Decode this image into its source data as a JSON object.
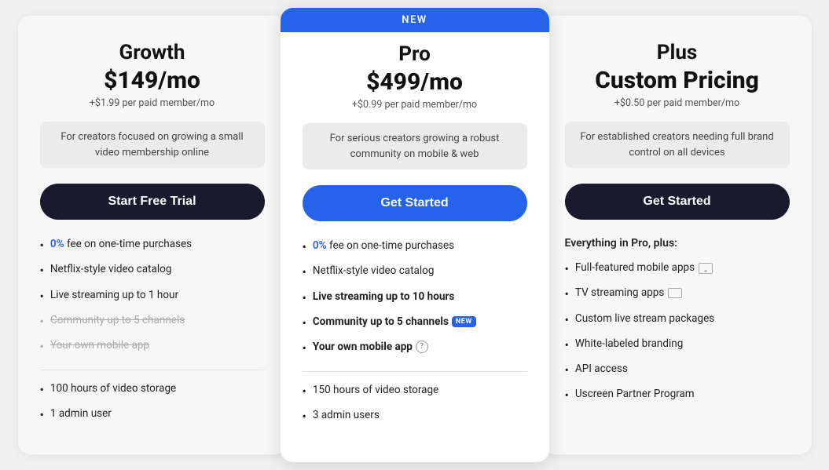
{
  "plans": [
    {
      "id": "growth",
      "position": "left",
      "name": "Growth",
      "price": "$149/mo",
      "per_member": "+$1.99 per paid member/mo",
      "description": "For creators focused on growing a small video membership online",
      "cta_label": "Start Free Trial",
      "cta_style": "dark",
      "is_new": false,
      "features_top": [
        {
          "text_parts": [
            {
              "text": "0%",
              "blue": true
            },
            {
              "text": " fee on one-time purchases"
            }
          ],
          "strikethrough": false
        },
        {
          "text_parts": [
            {
              "text": "Netflix-style video catalog"
            }
          ],
          "strikethrough": false
        },
        {
          "text_parts": [
            {
              "text": "Live streaming up to 1 hour"
            }
          ],
          "strikethrough": false
        },
        {
          "text_parts": [
            {
              "text": "Community up to 5 channels"
            }
          ],
          "strikethrough": true
        },
        {
          "text_parts": [
            {
              "text": "Your own mobile app"
            }
          ],
          "strikethrough": true
        }
      ],
      "features_bottom": [
        {
          "text_parts": [
            {
              "text": "100 hours of video storage"
            }
          ],
          "strikethrough": false
        },
        {
          "text_parts": [
            {
              "text": "1 admin user"
            }
          ],
          "strikethrough": false
        }
      ]
    },
    {
      "id": "pro",
      "position": "middle",
      "name": "Pro",
      "price": "$499/mo",
      "per_member": "+$0.99 per paid member/mo",
      "description": "For serious creators growing a robust community on mobile & web",
      "cta_label": "Get Started",
      "cta_style": "blue",
      "is_new": true,
      "features_top": [
        {
          "text_parts": [
            {
              "text": "0%",
              "blue": true
            },
            {
              "text": " fee on one-time purchases"
            }
          ],
          "strikethrough": false
        },
        {
          "text_parts": [
            {
              "text": "Netflix-style video catalog"
            }
          ],
          "strikethrough": false
        },
        {
          "text_parts": [
            {
              "text": "Live streaming up to 10 hours",
              "bold": true
            }
          ],
          "strikethrough": false
        },
        {
          "text_parts": [
            {
              "text": "Community up to 5 channels",
              "bold": true
            },
            {
              "text": " NEW",
              "badge": true
            }
          ],
          "strikethrough": false
        },
        {
          "text_parts": [
            {
              "text": "Your own mobile app",
              "bold": true
            },
            {
              "text": " ?",
              "help": true
            }
          ],
          "strikethrough": false
        }
      ],
      "features_bottom": [
        {
          "text_parts": [
            {
              "text": "150 hours of video storage"
            }
          ],
          "strikethrough": false
        },
        {
          "text_parts": [
            {
              "text": "3 admin users"
            }
          ],
          "strikethrough": false
        }
      ]
    },
    {
      "id": "plus",
      "position": "right",
      "name": "Plus",
      "price_line1": "Custom Pricing",
      "per_member": "+$0.50 per paid member/mo",
      "description": "For established creators needing full brand control on all devices",
      "cta_label": "Get Started",
      "cta_style": "dark",
      "is_new": false,
      "everything_plus": "Everything in Pro, plus:",
      "features": [
        {
          "text": "Full-featured mobile apps",
          "icon": "mobile"
        },
        {
          "text": "TV streaming apps",
          "icon": "tv"
        },
        {
          "text": "Custom live stream packages",
          "icon": null
        },
        {
          "text": "White-labeled branding",
          "icon": null
        },
        {
          "text": "API access",
          "icon": null
        },
        {
          "text": "Uscreen Partner Program",
          "icon": null
        }
      ]
    }
  ],
  "new_badge_label": "NEW"
}
